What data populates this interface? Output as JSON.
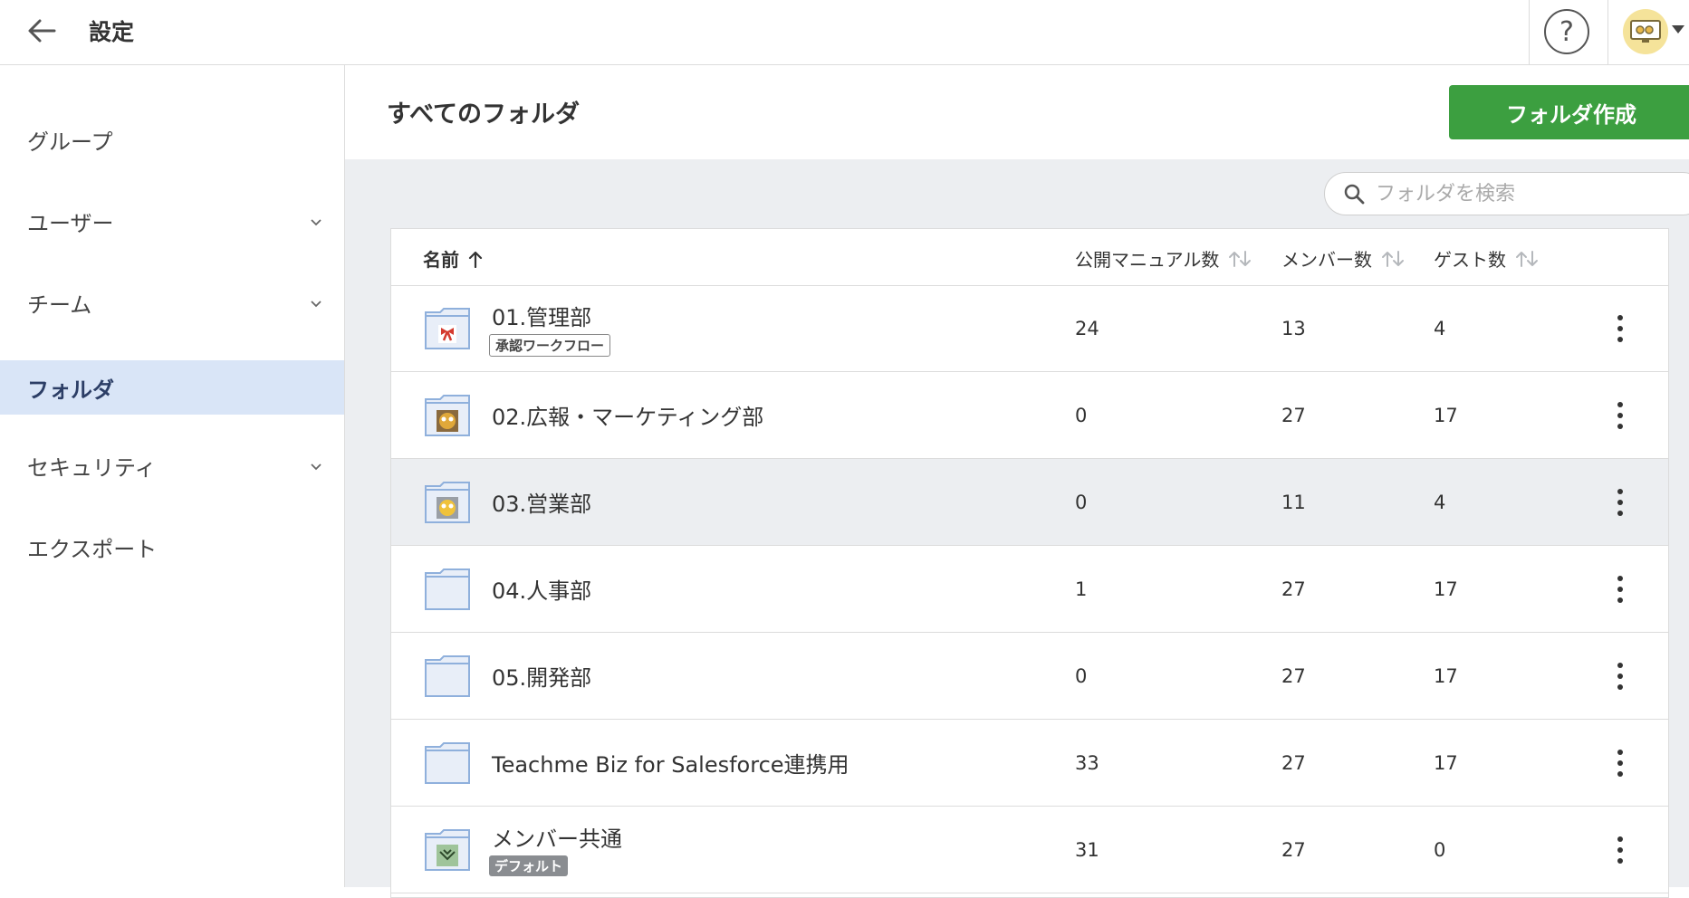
{
  "header": {
    "title": "設定",
    "help_label": "?"
  },
  "sidebar": {
    "items": [
      {
        "label": "グループ",
        "has_chevron": false
      },
      {
        "label": "ユーザー",
        "has_chevron": true
      },
      {
        "label": "チーム",
        "has_chevron": true
      },
      {
        "label": "フォルダ",
        "has_chevron": false,
        "active": true
      },
      {
        "label": "セキュリティ",
        "has_chevron": true
      },
      {
        "label": "エクスポート",
        "has_chevron": false
      }
    ]
  },
  "main": {
    "title": "すべてのフォルダ",
    "create_button": "フォルダ作成",
    "search": {
      "placeholder": "フォルダを検索",
      "value": ""
    },
    "table": {
      "columns": [
        "名前",
        "公開マニュアル数",
        "メンバー数",
        "ゲスト数"
      ],
      "rows": [
        {
          "name": "01.管理部",
          "badge": "承認ワークフロー",
          "badge_style": "outline",
          "icon": "ribbon",
          "manuals": "24",
          "members": "13",
          "guests": "4"
        },
        {
          "name": "02.広報・マーケティング部",
          "badge": "",
          "icon": "owl-brown",
          "manuals": "0",
          "members": "27",
          "guests": "17"
        },
        {
          "name": "03.営業部",
          "badge": "",
          "icon": "owl-yellow",
          "manuals": "0",
          "members": "11",
          "guests": "4",
          "highlighted": true
        },
        {
          "name": "04.人事部",
          "badge": "",
          "icon": "plain",
          "manuals": "1",
          "members": "27",
          "guests": "17"
        },
        {
          "name": "05.開発部",
          "badge": "",
          "icon": "plain",
          "manuals": "0",
          "members": "27",
          "guests": "17"
        },
        {
          "name": "Teachme Biz for Salesforce連携用",
          "badge": "",
          "icon": "plain",
          "manuals": "33",
          "members": "27",
          "guests": "17"
        },
        {
          "name": "メンバー共通",
          "badge": "デフォルト",
          "badge_style": "filled",
          "icon": "leaf-green",
          "manuals": "31",
          "members": "27",
          "guests": "0"
        }
      ]
    }
  },
  "colors": {
    "accent_green": "#3c9f40",
    "active_nav_bg": "#d9e5f7",
    "canvas_bg": "#eceef1",
    "folder_blue": "#8fb0dc"
  }
}
